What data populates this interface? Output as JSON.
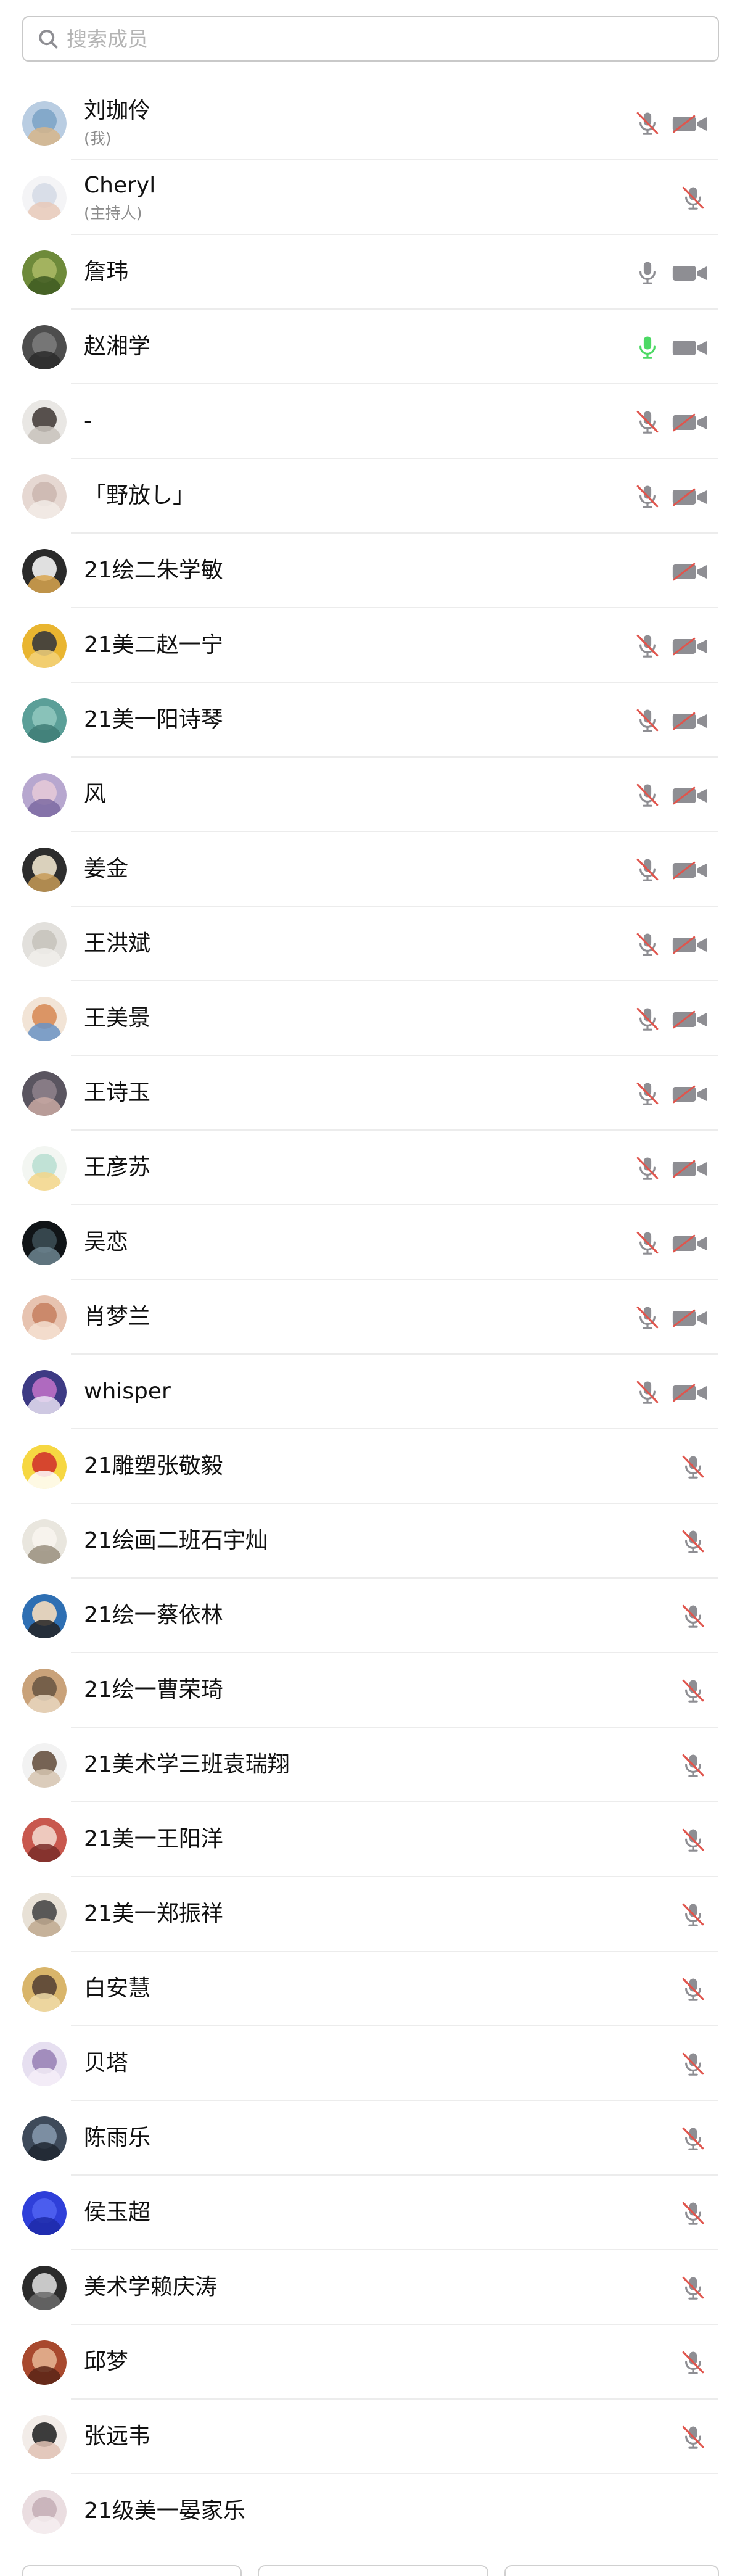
{
  "search": {
    "placeholder": "搜索成员"
  },
  "members": [
    {
      "name": "刘珈伶",
      "sub": "(我)",
      "mic": "muted",
      "cam": "off",
      "avatar": [
        "#b9cde2",
        "#7fa6c8",
        "#d6b58a"
      ]
    },
    {
      "name": "Cheryl",
      "sub": "(主持人)",
      "mic": "muted-alt",
      "cam": "none",
      "avatar": [
        "#f4f4f6",
        "#d6dbe6",
        "#e8c9b9"
      ]
    },
    {
      "name": "詹玮",
      "mic": "on",
      "cam": "on",
      "avatar": [
        "#6e8a3a",
        "#a7b663",
        "#3f5b22"
      ]
    },
    {
      "name": "赵湘学",
      "mic": "active",
      "cam": "on",
      "avatar": [
        "#4d4d4d",
        "#7a7a7a",
        "#2b2b2b"
      ]
    },
    {
      "name": "-",
      "mic": "muted",
      "cam": "off",
      "avatar": [
        "#e9e7e4",
        "#4a4340",
        "#c8c2bc"
      ]
    },
    {
      "name": "「野放し」",
      "mic": "muted",
      "cam": "off",
      "avatar": [
        "#e6d8d2",
        "#cdb9b1",
        "#f2ece8"
      ]
    },
    {
      "name": "21绘二朱学敏",
      "mic": "none",
      "cam": "off",
      "avatar": [
        "#2a2a2a",
        "#f0f0f0",
        "#d9a64f"
      ]
    },
    {
      "name": "21美二赵一宁",
      "mic": "muted",
      "cam": "off",
      "avatar": [
        "#e9b530",
        "#3d3d3d",
        "#f3d27a"
      ]
    },
    {
      "name": "21美一阳诗琴",
      "mic": "muted",
      "cam": "off",
      "avatar": [
        "#5b9f98",
        "#8dc4bc",
        "#3f7c76"
      ]
    },
    {
      "name": "风",
      "mic": "muted",
      "cam": "off",
      "avatar": [
        "#b7a7cf",
        "#e3c8d8",
        "#7d6aa2"
      ]
    },
    {
      "name": "姜金",
      "mic": "muted",
      "cam": "off",
      "avatar": [
        "#2d2d2d",
        "#e9dfc9",
        "#c79b57"
      ]
    },
    {
      "name": "王洪斌",
      "mic": "muted",
      "cam": "off",
      "avatar": [
        "#e2e0dc",
        "#c8c4bd",
        "#f1efeb"
      ]
    },
    {
      "name": "王美景",
      "mic": "muted",
      "cam": "off",
      "avatar": [
        "#f2e4d6",
        "#d98e5b",
        "#6a93c4"
      ]
    },
    {
      "name": "王诗玉",
      "mic": "muted",
      "cam": "off",
      "avatar": [
        "#5a5560",
        "#8b7f89",
        "#c9a9a2"
      ]
    },
    {
      "name": "王彦苏",
      "mic": "muted",
      "cam": "off",
      "avatar": [
        "#f3f6f2",
        "#bde0d4",
        "#f3d68a"
      ]
    },
    {
      "name": "吴恋",
      "mic": "muted",
      "cam": "off",
      "avatar": [
        "#101417",
        "#3a4b52",
        "#6d8590"
      ]
    },
    {
      "name": "肖梦兰",
      "mic": "muted",
      "cam": "off",
      "avatar": [
        "#e7c3b0",
        "#c98465",
        "#f5e0d1"
      ]
    },
    {
      "name": "whisper",
      "mic": "muted",
      "cam": "off",
      "avatar": [
        "#3d3a84",
        "#b96fc4",
        "#e7e2f2"
      ]
    },
    {
      "name": "21雕塑张敬毅",
      "mic": "muted-alt",
      "cam": "none",
      "avatar": [
        "#f6d742",
        "#d33a2c",
        "#ffffff"
      ]
    },
    {
      "name": "21绘画二班石宇灿",
      "mic": "muted-alt",
      "cam": "none",
      "avatar": [
        "#e9e6de",
        "#f7f4ee",
        "#9a8f7f"
      ]
    },
    {
      "name": "21绘一蔡依林",
      "mic": "muted-alt",
      "cam": "none",
      "avatar": [
        "#2e6fb3",
        "#f1d9bd",
        "#232323"
      ]
    },
    {
      "name": "21绘一曹荣琦",
      "mic": "muted-alt",
      "cam": "none",
      "avatar": [
        "#c9a27a",
        "#6f5a45",
        "#e9d7c0"
      ]
    },
    {
      "name": "21美术学三班袁瑞翔",
      "mic": "muted-alt",
      "cam": "none",
      "avatar": [
        "#f2f2f2",
        "#6b5746",
        "#d7c5b2"
      ]
    },
    {
      "name": "21美一王阳洋",
      "mic": "muted-alt",
      "cam": "none",
      "avatar": [
        "#c8584e",
        "#f1d3c8",
        "#7a2d29"
      ]
    },
    {
      "name": "21美一郑振祥",
      "mic": "muted-alt",
      "cam": "none",
      "avatar": [
        "#e8e1d6",
        "#4c4c4c",
        "#bfa98f"
      ]
    },
    {
      "name": "白安慧",
      "mic": "muted-alt",
      "cam": "none",
      "avatar": [
        "#d9b56a",
        "#5b4636",
        "#f0dca8"
      ]
    },
    {
      "name": "贝塔",
      "mic": "muted-alt",
      "cam": "none",
      "avatar": [
        "#e6dff0",
        "#9c86b8",
        "#f4eef8"
      ]
    },
    {
      "name": "陈雨乐",
      "mic": "muted-alt",
      "cam": "none",
      "avatar": [
        "#3e4a5a",
        "#8194a8",
        "#1f2630"
      ]
    },
    {
      "name": "侯玉超",
      "mic": "muted-alt",
      "cam": "none",
      "avatar": [
        "#2f3fd9",
        "#4e5ff0",
        "#1d2aa8"
      ]
    },
    {
      "name": "美术学赖庆涛",
      "mic": "muted-alt",
      "cam": "none",
      "avatar": [
        "#2b2b2b",
        "#d6d6d6",
        "#6b6b6b"
      ]
    },
    {
      "name": "邱梦",
      "mic": "muted-alt",
      "cam": "none",
      "avatar": [
        "#a8492e",
        "#e3b08e",
        "#5a2416"
      ]
    },
    {
      "name": "张远韦",
      "mic": "muted-alt",
      "cam": "none",
      "avatar": [
        "#f2ece8",
        "#2c2c2c",
        "#e0c2b4"
      ]
    },
    {
      "name": "21级美一晏家乐",
      "mic": "none",
      "cam": "none",
      "avatar": [
        "#eadde0",
        "#c7b1b8",
        "#f6eef0"
      ]
    }
  ],
  "colors": {
    "icon_gray": "#8e8e93",
    "mute_slash": "#e0554d",
    "active_green": "#4cd964",
    "divider": "#ececec",
    "secondary_text": "#8d8d8d"
  },
  "icons": {
    "search": "search-icon",
    "mic": "microphone-icon",
    "mic_muted": "microphone-muted-icon",
    "cam": "camera-icon",
    "cam_off": "camera-off-icon"
  }
}
